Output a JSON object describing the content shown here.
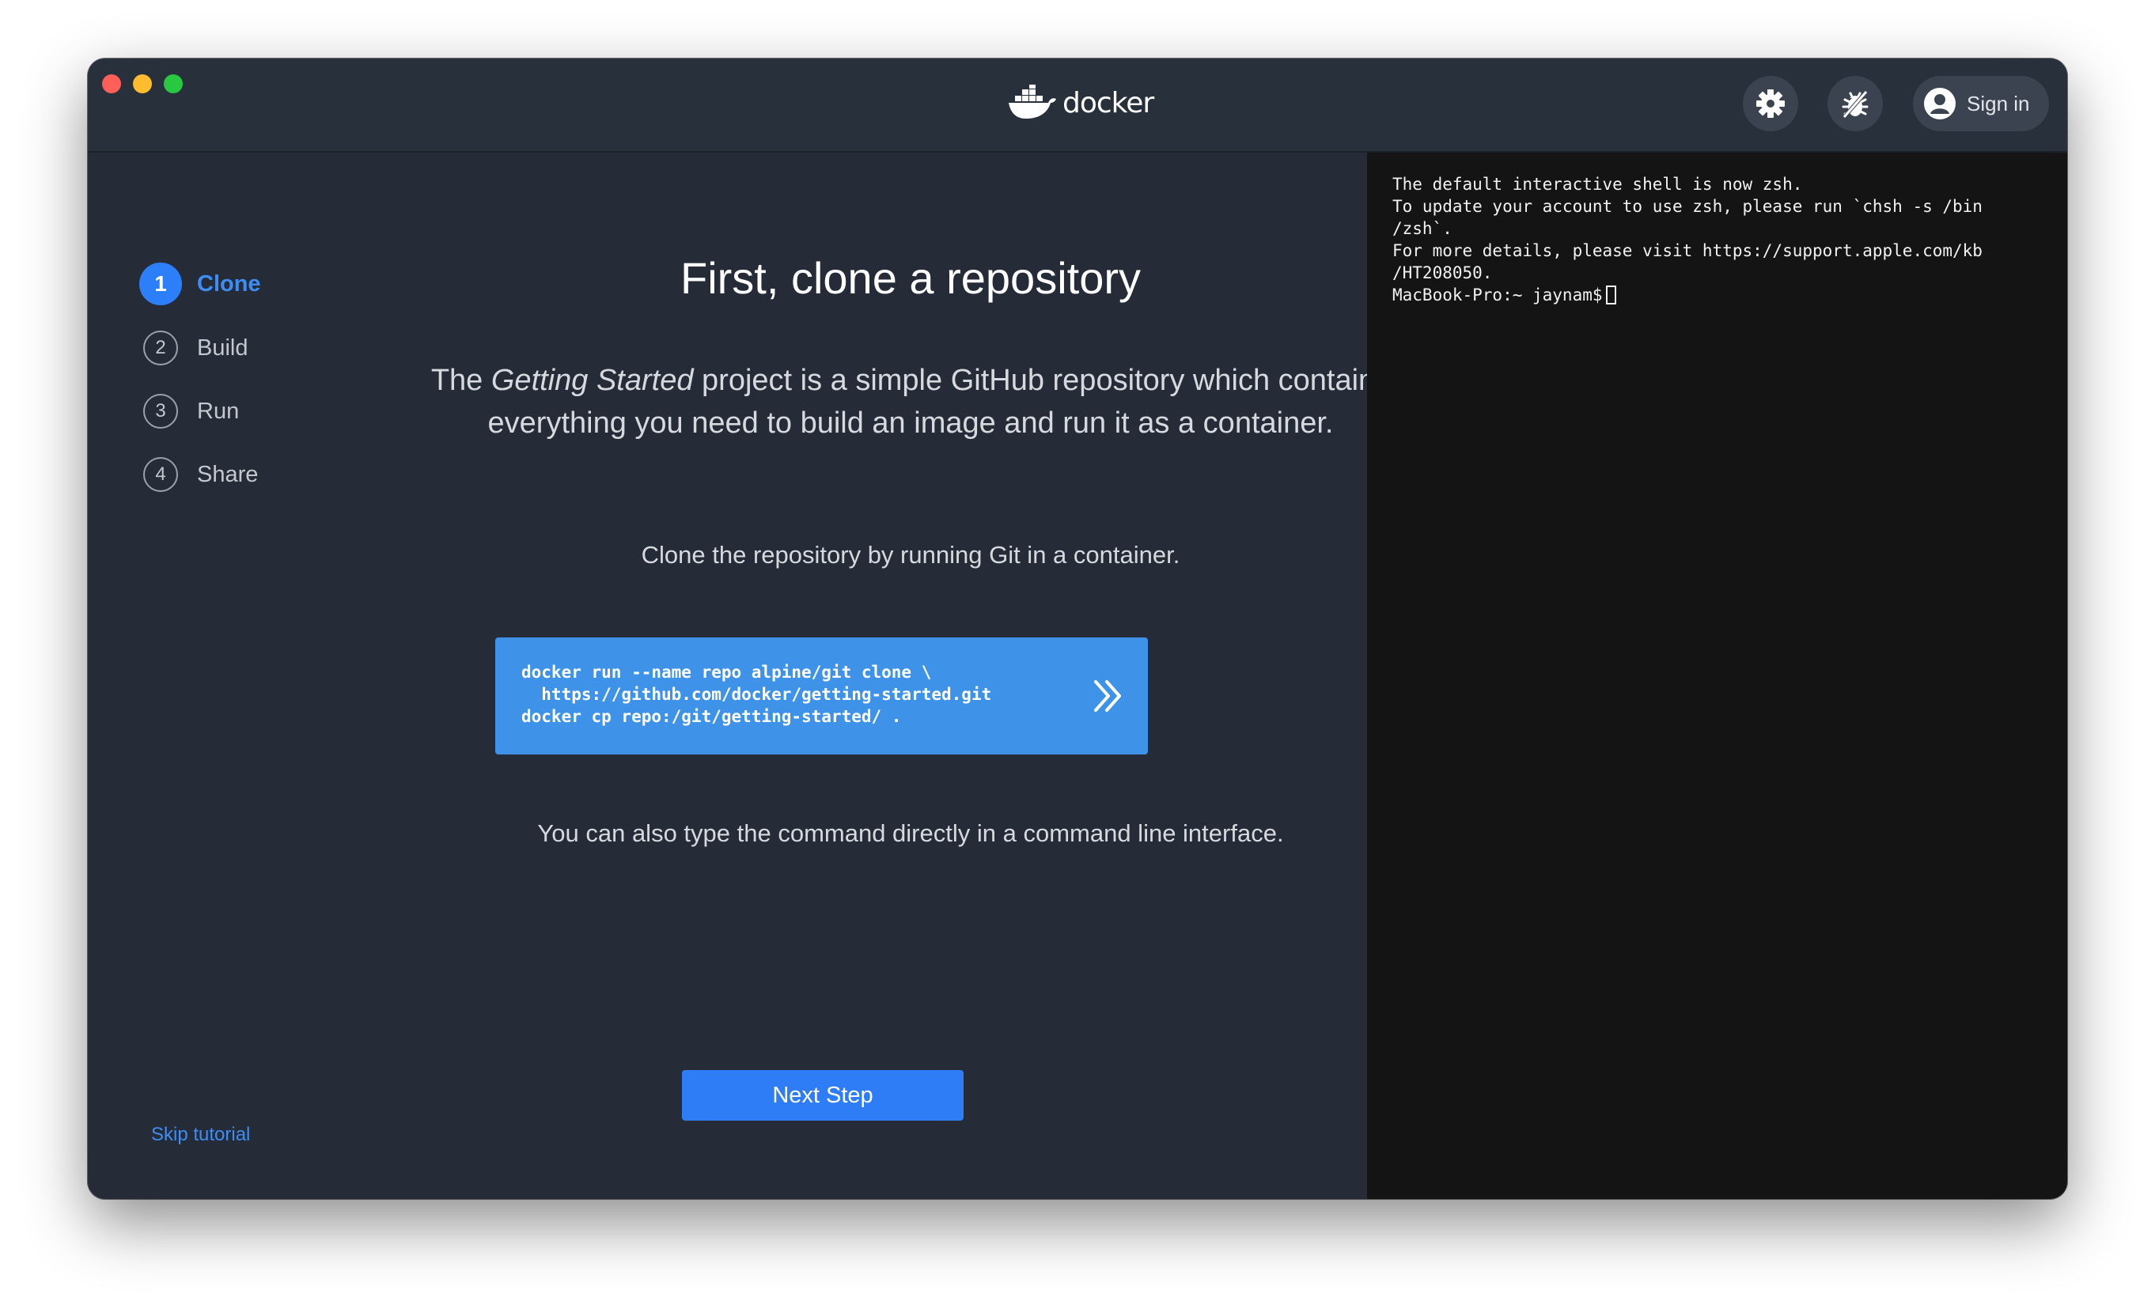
{
  "window": {
    "logo_text": "docker"
  },
  "header": {
    "settings_icon": "gear-icon",
    "troubleshoot_icon": "bug-icon",
    "signin_label": "Sign in"
  },
  "sidebar": {
    "steps": [
      {
        "number": "1",
        "label": "Clone",
        "active": true
      },
      {
        "number": "2",
        "label": "Build",
        "active": false
      },
      {
        "number": "3",
        "label": "Run",
        "active": false
      },
      {
        "number": "4",
        "label": "Share",
        "active": false
      }
    ],
    "skip_label": "Skip tutorial"
  },
  "main": {
    "title": "First, clone a repository",
    "intro_prefix": "The ",
    "intro_emphasis": "Getting Started",
    "intro_suffix": " project is a simple GitHub repository which contains everything you need to build an image and run it as a container.",
    "clone_hint": "Clone the repository by running Git in a container.",
    "command_lines": [
      "docker run --name repo alpine/git clone \\",
      "  https://github.com/docker/getting-started.git",
      "docker cp repo:/git/getting-started/ ."
    ],
    "alt_hint": "You can also type the command directly in a command line interface.",
    "next_label": "Next Step"
  },
  "terminal": {
    "lines": [
      "The default interactive shell is now zsh.",
      "To update your account to use zsh, please run `chsh -s /bin",
      "/zsh`.",
      "For more details, please visit https://support.apple.com/kb",
      "/HT208050."
    ],
    "prompt": "MacBook-Pro:~ jaynam$"
  },
  "colors": {
    "accent": "#2d7ff9",
    "command_bg": "#3e93e9",
    "window_bg": "#252c37",
    "terminal_bg": "#141414"
  }
}
